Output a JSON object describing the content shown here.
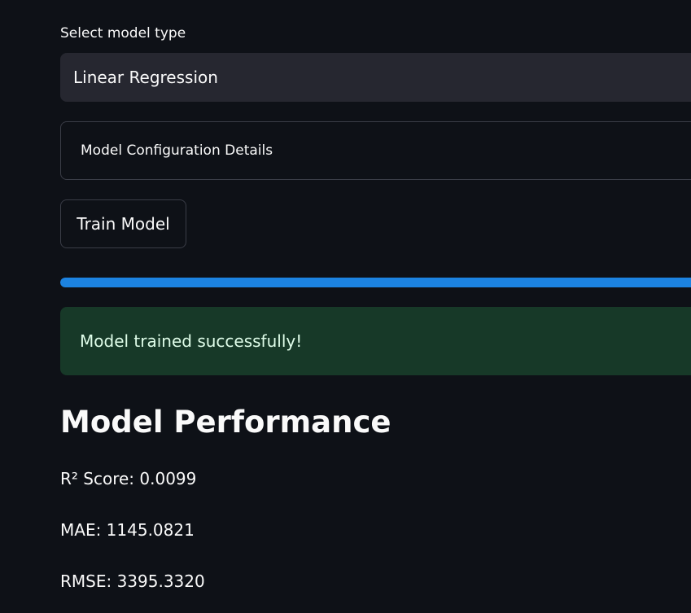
{
  "model_select": {
    "label": "Select model type",
    "value": "Linear Regression"
  },
  "expander": {
    "label": "Model Configuration Details"
  },
  "train_button": {
    "label": "Train Model"
  },
  "progress": {
    "value": 1.0
  },
  "alert": {
    "message": "Model trained successfully!"
  },
  "performance": {
    "heading": "Model Performance",
    "r2": "R² Score: 0.0099",
    "mae": "MAE: 1145.0821",
    "rmse": "RMSE: 3395.3320"
  },
  "colors": {
    "background": "#0e1117",
    "select_bg": "#262730",
    "progress": "#1c83e1",
    "success_bg": "#173928",
    "success_text": "#dffde9"
  }
}
